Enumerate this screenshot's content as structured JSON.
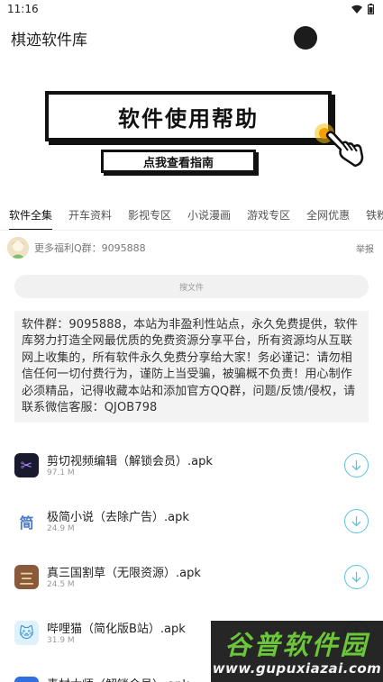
{
  "status_bar": {
    "time": "11:16"
  },
  "header": {
    "title": "棋迹软件库"
  },
  "banner": {
    "title": "软件使用帮助",
    "subtitle": "点我查看指南"
  },
  "tabs": [
    {
      "label": "软件全集"
    },
    {
      "label": "开车资料"
    },
    {
      "label": "影视专区"
    },
    {
      "label": "小说漫画"
    },
    {
      "label": "游戏专区"
    },
    {
      "label": "全网优惠"
    },
    {
      "label": "铁粉必看"
    }
  ],
  "notice": {
    "text": "更多福利Q群：9095888",
    "report": "举报"
  },
  "search": {
    "placeholder": "搜文件"
  },
  "info": {
    "text": "软件群：9095888，本站为非盈利性站点，永久免费提供，软件库努力打造全网最优质的免费资源分享平台，所有资源均从互联网上收集的，所有软件永久免费分享给大家！务必谨记：请勿相信任何一切付费行为，谨防上当受骗，被骗概不负责！用心制作必须精品，记得收藏本站和添加官方QQ群，问题/反馈/侵权，请联系微信客服：QJOB798"
  },
  "files": [
    {
      "name": "剪切视频编辑（解锁会员）.apk",
      "size": "97.1 M",
      "icon": "scissors-app-icon",
      "icon_bg": "#1a1a2e",
      "icon_fg": "#b08cff",
      "glyph": "✂"
    },
    {
      "name": "极简小说（去除广告）.apk",
      "size": "24.9 M",
      "icon": "jian-app-icon",
      "icon_bg": "#ffffff",
      "icon_fg": "#4a78c8",
      "glyph": "简"
    },
    {
      "name": "真三国割草（无限资源）.apk",
      "size": "24.5 M",
      "icon": "three-kingdoms-app-icon",
      "icon_bg": "#8a5a3c",
      "icon_fg": "#f0d29a",
      "glyph": "三"
    },
    {
      "name": "哔哩猫（简化版B站）.apk",
      "size": "31.9 M",
      "icon": "bili-cat-app-icon",
      "icon_bg": "#dff1fb",
      "icon_fg": "#2f93d6",
      "glyph": "🐱"
    },
    {
      "name": "素材大师（解锁会员）.apk",
      "size": "",
      "icon": "material-app-icon",
      "icon_bg": "#2f6fe0",
      "icon_fg": "#ffffff",
      "glyph": "素"
    }
  ],
  "watermark": {
    "title": "谷普软件园",
    "url": "www.gupuxiazai.com"
  },
  "colors": {
    "accent": "#5cc3e0",
    "watermark_green": "#6cc63a"
  }
}
